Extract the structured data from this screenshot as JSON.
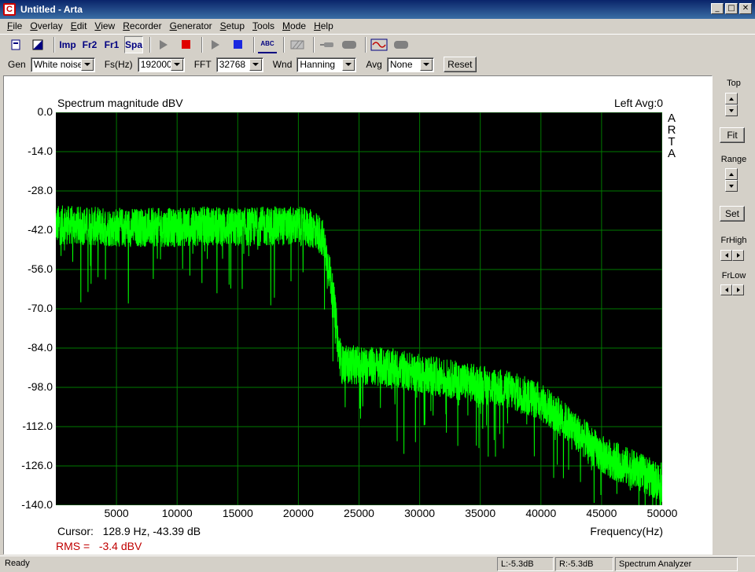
{
  "window": {
    "title": "Untitled - Arta",
    "app_icon": "C"
  },
  "menu": [
    {
      "key": "F",
      "rest": "ile"
    },
    {
      "key": "O",
      "rest": "verlay"
    },
    {
      "key": "E",
      "rest": "dit"
    },
    {
      "key": "V",
      "rest": "iew"
    },
    {
      "key": "R",
      "rest": "ecorder"
    },
    {
      "key": "G",
      "rest": "enerator"
    },
    {
      "key": "S",
      "rest": "etup"
    },
    {
      "key": "T",
      "rest": "ools"
    },
    {
      "key": "M",
      "rest": "ode"
    },
    {
      "key": "H",
      "rest": "elp"
    }
  ],
  "toolbar": {
    "imp_label": "Imp",
    "fr2_label": "Fr2",
    "fr1_label": "Fr1",
    "spa_label": "Spa",
    "abc_label": "ABC"
  },
  "settings": {
    "gen_label": "Gen",
    "gen_value": "White noise",
    "fs_label": "Fs(Hz)",
    "fs_value": "192000",
    "fft_label": "FFT",
    "fft_value": "32768",
    "wnd_label": "Wnd",
    "wnd_value": "Hanning",
    "avg_label": "Avg",
    "avg_value": "None",
    "reset_label": "Reset"
  },
  "side": {
    "top_label": "Top",
    "fit_label": "Fit",
    "range_label": "Range",
    "set_label": "Set",
    "frhigh_label": "FrHigh",
    "frlow_label": "FrLow"
  },
  "readout": {
    "cursor": "Cursor:   128.9 Hz, -43.39 dB",
    "rms": "RMS =   -3.4 dBV"
  },
  "status": {
    "ready": "Ready",
    "left": "L:-5.3dB",
    "right": "R:-5.3dB",
    "mode": "Spectrum Analyzer"
  },
  "colors": {
    "trace": "#00ff00",
    "grid": "#007a00",
    "plot_bg": "#000000",
    "rms_text": "#c00000"
  },
  "chart_data": {
    "type": "line",
    "title": "Spectrum magnitude dBV",
    "channel_info": "Left  Avg:0",
    "side_label": [
      "A",
      "R",
      "T",
      "A"
    ],
    "xlabel": "Frequency(Hz)",
    "ylabel": "",
    "xlim": [
      0,
      50000
    ],
    "ylim": [
      -140,
      0
    ],
    "x_ticks": [
      5000,
      10000,
      15000,
      20000,
      25000,
      30000,
      35000,
      40000,
      45000,
      50000
    ],
    "y_ticks": [
      "0.0",
      "-14.0",
      "-28.0",
      "-42.0",
      "-56.0",
      "-70.0",
      "-84.0",
      "-98.0",
      "-112.0",
      "-126.0",
      "-140.0"
    ],
    "grid": true,
    "series": [
      {
        "x": [
          0,
          2500,
          5000,
          7500,
          10000,
          12500,
          15000,
          17500,
          20000,
          21500,
          22000,
          22500,
          23000,
          23300,
          23600,
          25000,
          27500,
          30000,
          32500,
          35000,
          37500,
          40000,
          42500,
          45000,
          47500,
          50000
        ],
        "y": [
          -40,
          -40.5,
          -41,
          -41,
          -41,
          -40.5,
          -41,
          -40.5,
          -40.5,
          -42,
          -45,
          -55,
          -70,
          -84,
          -90,
          -90,
          -91,
          -93,
          -95,
          -97,
          -99,
          -103,
          -112,
          -122,
          -127,
          -132
        ]
      }
    ]
  }
}
